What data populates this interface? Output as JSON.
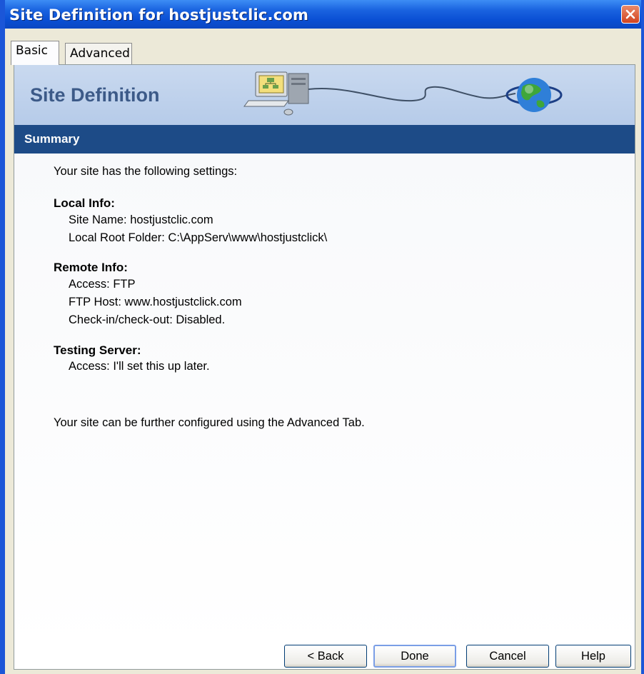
{
  "window": {
    "title": "Site Definition for hostjustclic.com"
  },
  "tabs": [
    {
      "label": "Basic"
    },
    {
      "label": "Advanced"
    }
  ],
  "banner": {
    "title": "Site Definition"
  },
  "summary": {
    "label": "Summary"
  },
  "content": {
    "intro": "Your site has the following settings:",
    "local_info": {
      "heading": "Local Info:",
      "lines": [
        "Site Name: hostjustclic.com",
        "Local Root Folder: C:\\AppServ\\www\\hostjustclick\\"
      ]
    },
    "remote_info": {
      "heading": "Remote Info:",
      "lines": [
        "Access: FTP",
        "FTP Host: www.hostjustclick.com",
        "Check-in/check-out: Disabled."
      ]
    },
    "testing_server": {
      "heading": "Testing Server:",
      "lines": [
        "Access: I'll set this up later."
      ]
    },
    "footer_note": "Your site can be further configured using the Advanced Tab."
  },
  "buttons": {
    "back": "< Back",
    "done": "Done",
    "cancel": "Cancel",
    "help": "Help"
  },
  "icons": {
    "close": "close-icon",
    "computer": "computer-icon",
    "globe": "globe-icon"
  },
  "colors": {
    "titlebar": "#0a4fd4",
    "summary_bar": "#1d4b87",
    "banner": "#c9d9ef",
    "banner_title": "#3c5a88",
    "close_button": "#d2431f"
  }
}
